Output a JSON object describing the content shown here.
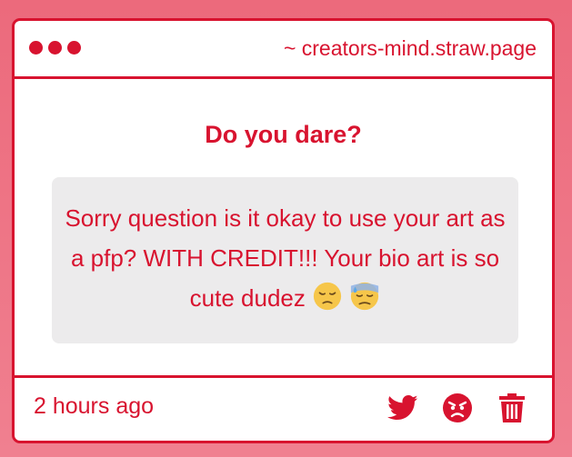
{
  "window": {
    "url": "~ creators-mind.straw.page"
  },
  "question": {
    "heading": "Do you dare?",
    "message": "Sorry question is it okay to use your art as a pfp? WITH CREDIT!!! Your bio art is so cute dudez",
    "emojis": [
      "pensive-face-emoji",
      "downcast-face-with-sweat-emoji"
    ]
  },
  "footer": {
    "timestamp": "2 hours ago",
    "actions": [
      "twitter-icon",
      "angry-face-icon",
      "trash-icon"
    ]
  },
  "colors": {
    "accent": "#d8132f",
    "background": "#ec6a7c",
    "bubble": "#ecebec"
  }
}
